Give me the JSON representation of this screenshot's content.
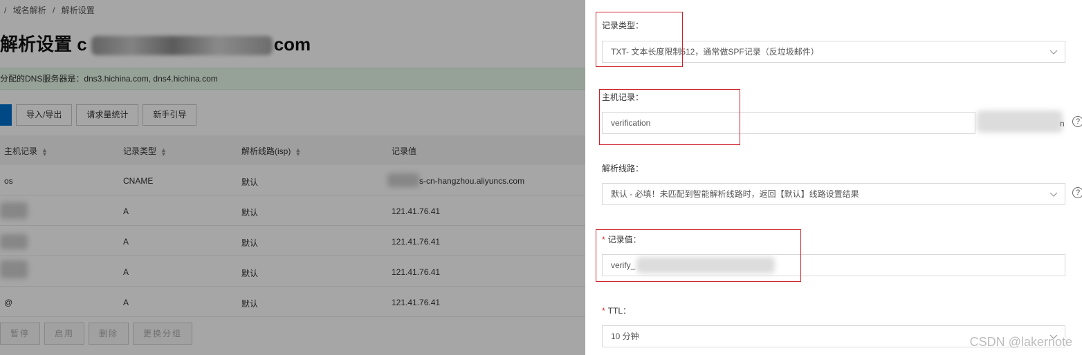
{
  "breadcrumb": {
    "sep": "/",
    "items": [
      "域名解析",
      "解析设置"
    ]
  },
  "page": {
    "title_prefix": "解析设置 c",
    "title_suffix": "com"
  },
  "dns_banner": {
    "text": "分配的DNS服务器是：dns3.hichina.com, dns4.hichina.com"
  },
  "toolbar": {
    "buttons": [
      "导入/导出",
      "请求量统计",
      "新手引导"
    ]
  },
  "table": {
    "headers": [
      "主机记录",
      "记录类型",
      "解析线路(isp)",
      "记录值"
    ],
    "rows": [
      {
        "host": "os",
        "type": "CNAME",
        "line": "默认",
        "value": "s-cn-hangzhou.aliyuncs.com"
      },
      {
        "host": "",
        "type": "A",
        "line": "默认",
        "value": "121.41.76.41"
      },
      {
        "host": "",
        "type": "A",
        "line": "默认",
        "value": "121.41.76.41"
      },
      {
        "host": "",
        "type": "A",
        "line": "默认",
        "value": "121.41.76.41"
      },
      {
        "host": "@",
        "type": "A",
        "line": "默认",
        "value": "121.41.76.41"
      }
    ]
  },
  "bottom_bar": {
    "buttons": [
      "暂停",
      "启用",
      "删除",
      "更换分组"
    ]
  },
  "drawer": {
    "record_type": {
      "label": "记录类型：",
      "value": "TXT- 文本长度限制512，通常做SPF记录（反垃圾邮件）"
    },
    "host_record": {
      "label": "主机记录：",
      "value": "verification",
      "suffix": "n"
    },
    "line": {
      "label": "解析线路：",
      "value": "默认 - 必填！未匹配到智能解析线路时，返回【默认】线路设置结果"
    },
    "record_value": {
      "required_mark": "*",
      "label": "记录值：",
      "value": "verify_"
    },
    "ttl": {
      "required_mark": "*",
      "label": "TTL：",
      "value": "10 分钟"
    },
    "help_icon": "?"
  },
  "watermark": "CSDN @lakernote",
  "colors": {
    "primary": "#0070cc",
    "banner_bg": "#e6f7e9",
    "highlight": "#d0202a",
    "required": "#e02020"
  }
}
